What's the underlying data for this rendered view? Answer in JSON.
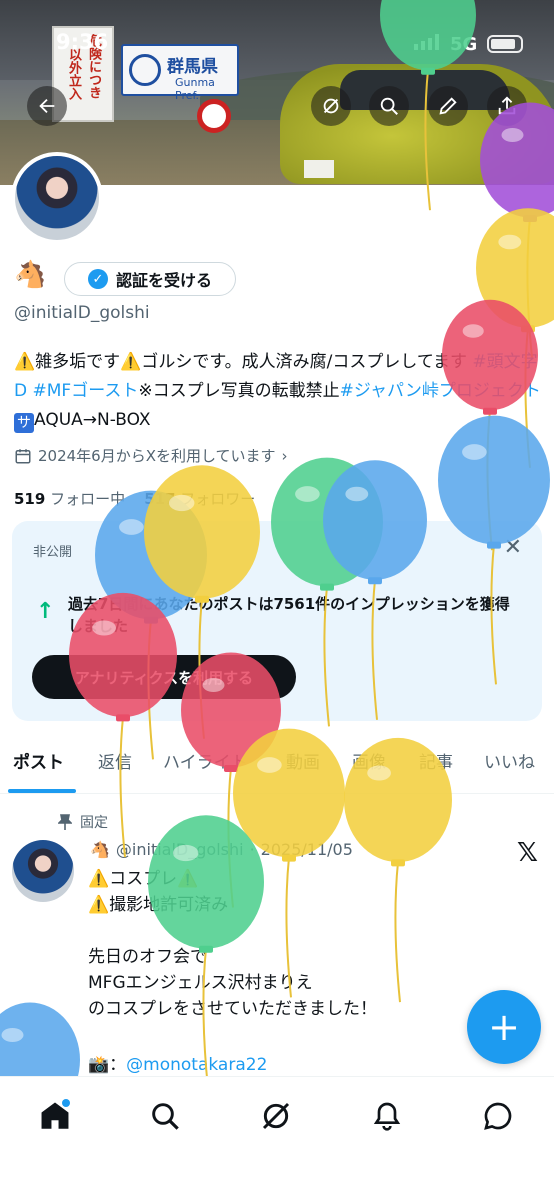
{
  "status_bar": {
    "time": "9:36",
    "network": "5G"
  },
  "banner": {
    "sign_text_1": "危険につき",
    "sign_text_2": "以外立入",
    "gunma_title": "群馬県",
    "gunma_sub": "Gunma Pref."
  },
  "profile": {
    "horse_emoji": "🐴",
    "verify_label": "認証を受ける",
    "handle": "@initialD_golshi",
    "bio_part1": "⚠️雑多垢です⚠️ゴルシです。成人済み腐/コスプレしてます",
    "bio_tag1": "#頭文字D",
    "bio_tag2": "#MFゴースト",
    "bio_part2": "※コスプレ写真の転載禁止",
    "bio_tag3": "#ジャパン峠プロジェクト",
    "bio_sa": "サ",
    "bio_part3": "AQUA→N-BOX",
    "joined": "2024年6月からXを利用しています",
    "following_count": "519",
    "following_label": "フォロー中",
    "followers_count": "517",
    "followers_label": "フォロワー"
  },
  "analytics_card": {
    "private_label": "非公開",
    "text": "過去7日間にあなたのポストは7561件のインプレッションを獲得しました",
    "button_label": "アナリティクスを利用する"
  },
  "tabs": [
    "ポスト",
    "返信",
    "ハイライト",
    "動画",
    "画像",
    "記事",
    "いいね"
  ],
  "pinned_post": {
    "pinned_label": "固定",
    "horse_emoji": "🐴",
    "handle": "@initialD_golshi",
    "dot": "·",
    "date": "2025/11/05",
    "body": "⚠️コスプレ⚠️\n⚠️撮影地許可済み\n\n先日のオフ会で\nMFGエンジェルス沢村まりえ\nのコスプレをさせていただきました！",
    "camera_emoji": "📸",
    "mention_sep": "：",
    "mention": "@monotakara22"
  },
  "fab_label": "+",
  "icons": [
    "back-icon",
    "grok-icon",
    "search-icon",
    "edit-icon",
    "share-icon",
    "home-icon",
    "explore-icon",
    "grok-nav-icon",
    "notifications-icon",
    "messages-icon"
  ],
  "balloon_colors": [
    "#5aa7ec",
    "#f2cf3f",
    "#e94d68",
    "#4fcf8e",
    "#a24fd8"
  ]
}
